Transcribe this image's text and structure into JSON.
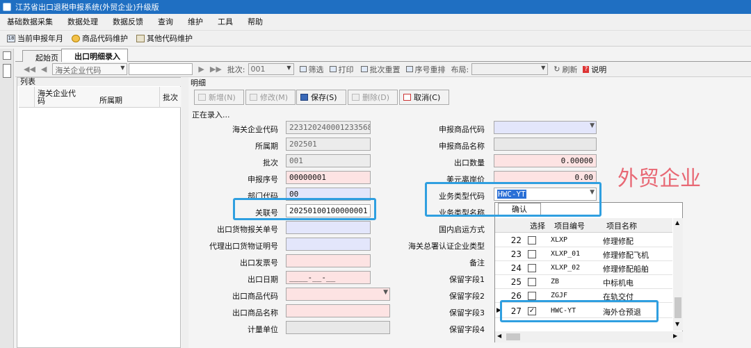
{
  "window": {
    "title": "江苏省出口退税申报系统(外贸企业)升级版"
  },
  "menu": [
    "基础数据采集",
    "数据处理",
    "数据反馈",
    "查询",
    "维护",
    "工具",
    "帮助"
  ],
  "toolbar": {
    "items": [
      "当前申报年月",
      "商品代码维护",
      "其他代码维护"
    ]
  },
  "tabs": [
    "起始页",
    "出口明细录入"
  ],
  "nav": {
    "company_code_combo": "海关企业代码",
    "batch_label": "批次:",
    "batch_value": "001",
    "filter": "筛选",
    "print": "打印",
    "batch_reset": "批次重置",
    "seq_reset": "序号重排",
    "layout_label": "布局:",
    "refresh": "刷新",
    "help": "说明"
  },
  "list": {
    "title": "列表",
    "columns": [
      "海关企业代码",
      "所属期",
      "批次"
    ]
  },
  "detail": {
    "title": "明细",
    "buttons": {
      "add": "新增(N)",
      "edit": "修改(M)",
      "save": "保存(S)",
      "delete": "删除(D)",
      "cancel": "取消(C)"
    },
    "status": "正在录入...",
    "left_fields": [
      {
        "label": "海关企业代码",
        "value": "223120240001233568"
      },
      {
        "label": "所属期",
        "value": "202501"
      },
      {
        "label": "批次",
        "value": "001"
      },
      {
        "label": "申报序号",
        "value": "00000001"
      },
      {
        "label": "部门代码",
        "value": "00"
      },
      {
        "label": "关联号",
        "value": "20250100100000001"
      },
      {
        "label": "出口货物报关单号",
        "value": ""
      },
      {
        "label": "代理出口货物证明号",
        "value": ""
      },
      {
        "label": "出口发票号",
        "value": ""
      },
      {
        "label": "出口日期",
        "value": "____-__-__"
      },
      {
        "label": "出口商品代码",
        "value": ""
      },
      {
        "label": "出口商品名称",
        "value": ""
      },
      {
        "label": "计量单位",
        "value": ""
      }
    ],
    "right_fields": [
      {
        "label": "申报商品代码",
        "value": ""
      },
      {
        "label": "申报商品名称",
        "value": ""
      },
      {
        "label": "出口数量",
        "value": "0.00000"
      },
      {
        "label": "美元离岸价",
        "value": "0.00"
      },
      {
        "label": "业务类型代码",
        "value": "HWC-YT"
      },
      {
        "label": "业务类型名称",
        "value": ""
      },
      {
        "label": "国内启运方式",
        "value": ""
      },
      {
        "label": "海关总署认证企业类型",
        "value": ""
      },
      {
        "label": "备注",
        "value": ""
      },
      {
        "label": "保留字段1",
        "value": ""
      },
      {
        "label": "保留字段2",
        "value": ""
      },
      {
        "label": "保留字段3",
        "value": ""
      },
      {
        "label": "保留字段4",
        "value": ""
      }
    ]
  },
  "annotation": "外贸企业",
  "popup": {
    "confirm": "确认",
    "headers": [
      "选择",
      "项目编号",
      "项目名称"
    ],
    "rows": [
      {
        "n": "22",
        "checked": "",
        "code": "XLXP",
        "name": "修理修配"
      },
      {
        "n": "23",
        "checked": "",
        "code": "XLXP_01",
        "name": "修理修配飞机"
      },
      {
        "n": "24",
        "checked": "",
        "code": "XLXP_02",
        "name": "修理修配船舶"
      },
      {
        "n": "25",
        "checked": "",
        "code": "ZB",
        "name": "中标机电"
      },
      {
        "n": "26",
        "checked": "",
        "code": "ZGJF",
        "name": "在轨交付"
      },
      {
        "n": "27",
        "checked": "✓",
        "code": "HWC-YT",
        "name": "海外仓预退"
      }
    ]
  }
}
